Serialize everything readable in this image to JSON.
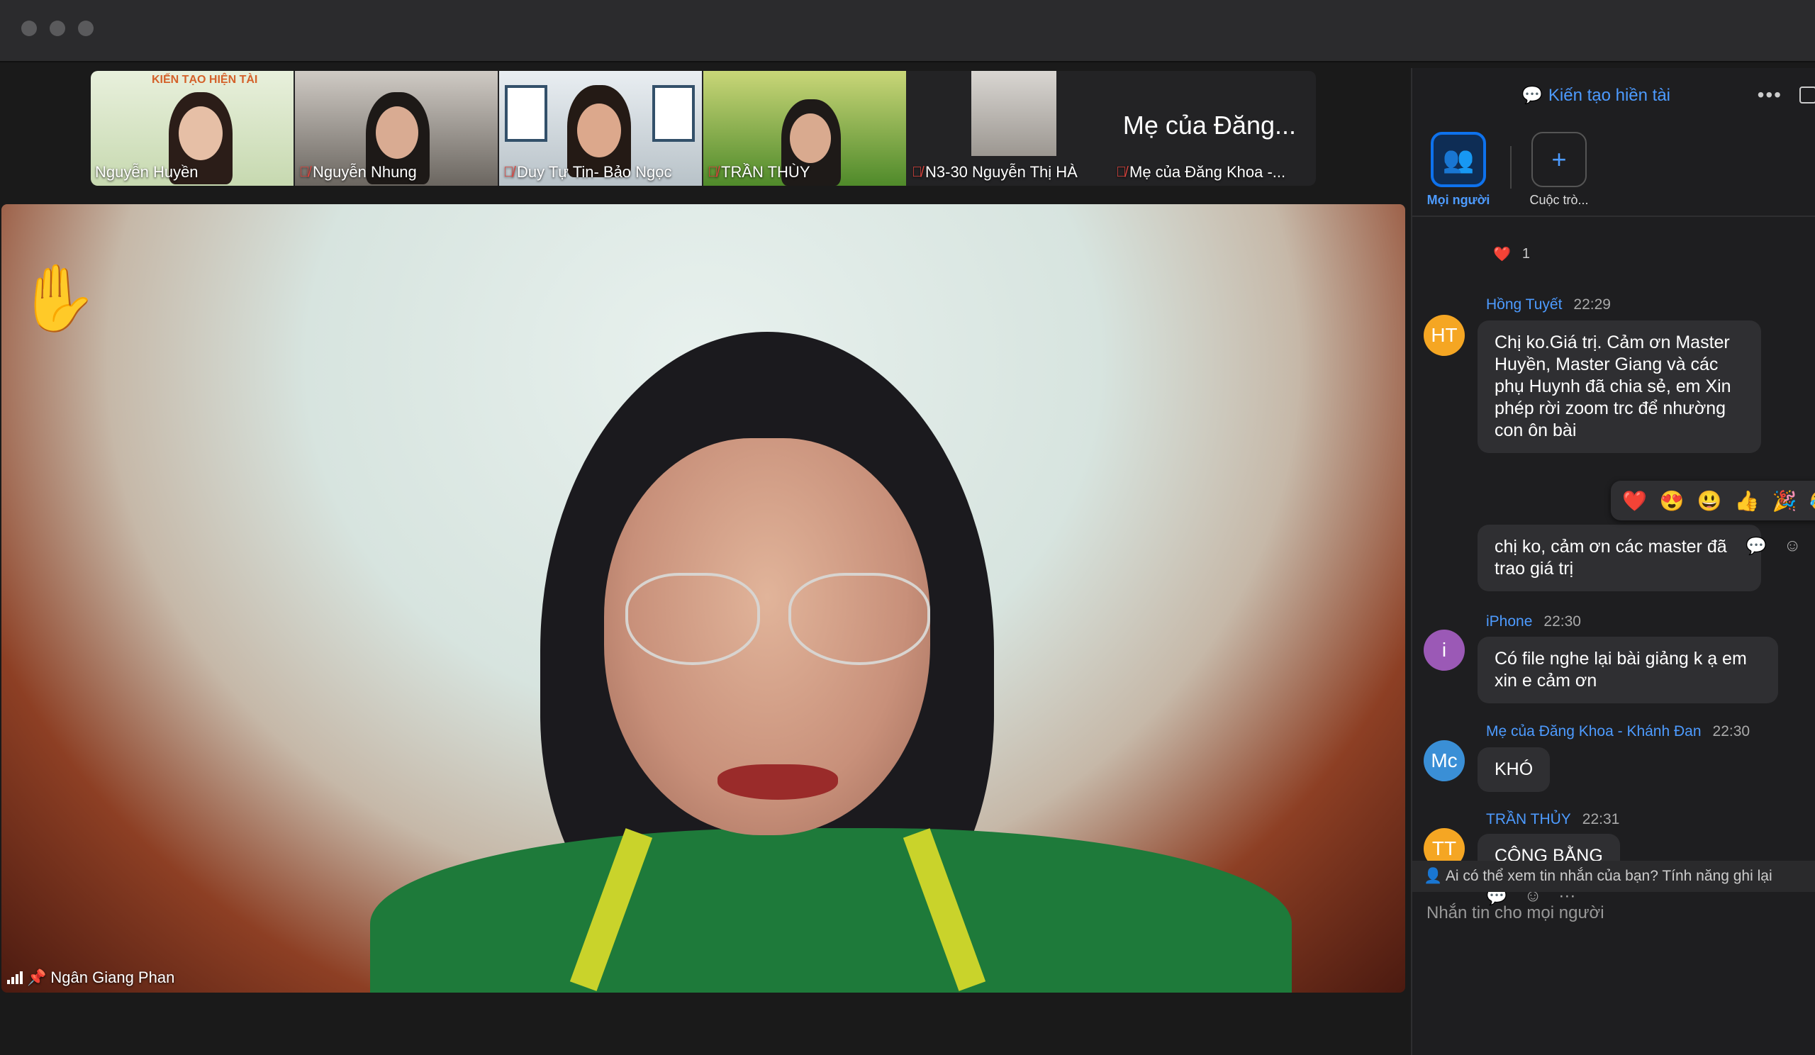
{
  "participants": [
    {
      "name": "Nguyễn Huyền",
      "muted": false
    },
    {
      "name": "Nguyễn Nhung",
      "muted": true
    },
    {
      "name": "Duy Tự Tin- Bảo Ngọc",
      "muted": true
    },
    {
      "name": "TRẦN THÙY",
      "muted": true
    },
    {
      "name": "N3-30 Nguyễn Thị HÀ",
      "muted": true
    },
    {
      "name": "Mẹ của Đăng Khoa -...",
      "muted": true
    }
  ],
  "tile_banner": "KIẾN TẠO HIỆN TÀI",
  "tile_big_name": "Mẹ của Đăng...",
  "main_speaker": "Ngân Giang Phan",
  "raised_hand": "✋",
  "panel": {
    "title": "Kiến tạo hiền tài",
    "tab_everyone": "Mọi người",
    "tab_conversation": "Cuộc trò...",
    "reaction_heart": "❤️",
    "reaction_count": "1"
  },
  "messages": [
    {
      "author": "Hồng Tuyết",
      "time": "22:29",
      "initials": "HT",
      "color": "#f5a623",
      "text1": "Chị ko.Giá trị. Cảm ơn Master Huyền, Master Giang và các phụ Huynh đã chia sẻ, em Xin phép rời zoom trc để nhường con ôn bài",
      "text2": "chị ko, cảm ơn các master đã trao giá trị"
    },
    {
      "author": "iPhone",
      "time": "22:30",
      "initials": "i",
      "color": "#9b59b6",
      "text1": "Có file nghe lại bài giảng k ạ em xin e cảm ơn"
    },
    {
      "author": "Mẹ của Đăng Khoa - Khánh Đan",
      "time": "22:30",
      "initials": "Mc",
      "color": "#3a8fd6",
      "text1": "KHÓ"
    },
    {
      "author": "TRẦN THỦY",
      "time": "22:31",
      "initials": "TT",
      "color": "#f5a623",
      "text1": "CÔNG BẰNG"
    }
  ],
  "emoji_picker": [
    "❤️",
    "😍",
    "😃",
    "👍",
    "🎉",
    "😂"
  ],
  "footer_note": "Ai có thể xem tin nhắn của bạn? Tính năng ghi lại",
  "input_placeholder": "Nhắn tin cho mọi người"
}
